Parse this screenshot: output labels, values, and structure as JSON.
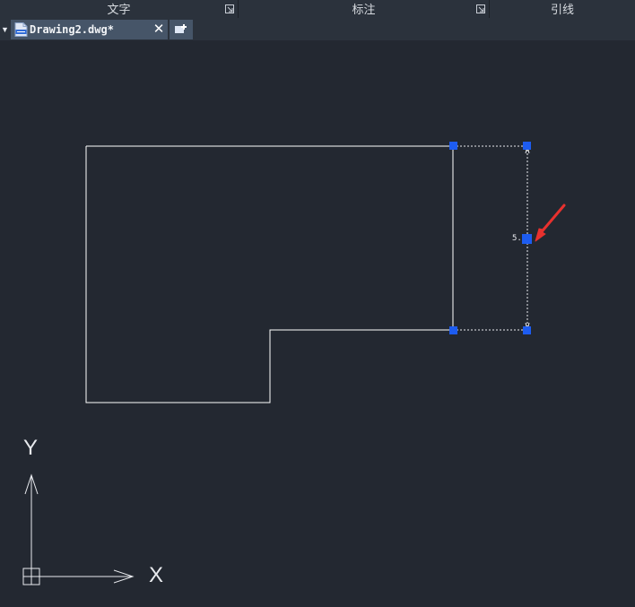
{
  "ribbon": {
    "panels": [
      {
        "label": "文字"
      },
      {
        "label": "标注"
      },
      {
        "label": "引线"
      }
    ]
  },
  "tabs": {
    "menu_glyph": "▼",
    "document_title": "Drawing2.dwg*",
    "close_glyph": "✕",
    "document_icon": "dwg-file-icon",
    "new_tab_icon": "new-tab-icon"
  },
  "drawing": {
    "dimension_text": "5.00",
    "ucs": {
      "x_label": "X",
      "y_label": "Y"
    }
  },
  "colors": {
    "background": "#232831",
    "grip": "#1d5cf0",
    "annotation_arrow": "#e8312e"
  }
}
